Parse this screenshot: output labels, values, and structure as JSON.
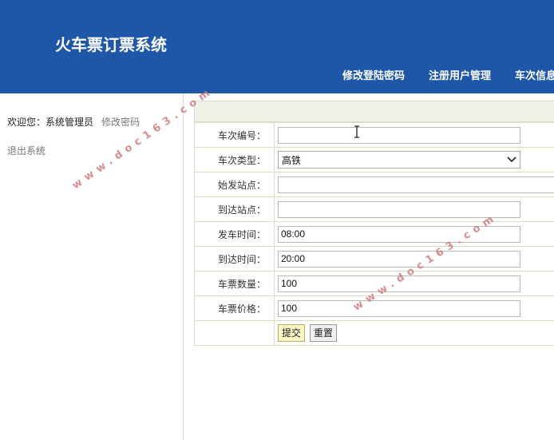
{
  "app": {
    "title": "火车票订票系统"
  },
  "nav": {
    "items": [
      {
        "label": "修改登陆密码"
      },
      {
        "label": "注册用户管理"
      },
      {
        "label": "车次信息"
      }
    ]
  },
  "sidebar": {
    "welcome_prefix": "欢迎您：",
    "user_role": "系统管理员",
    "change_password": "修改密码",
    "logout": "退出系统"
  },
  "form": {
    "fields": [
      {
        "label": "车次编号：",
        "value": ""
      },
      {
        "label": "车次类型：",
        "value": "高铁"
      },
      {
        "label": "始发站点：",
        "value": ""
      },
      {
        "label": "到达站点：",
        "value": ""
      },
      {
        "label": "发车时间：",
        "value": "08:00"
      },
      {
        "label": "到达时间：",
        "value": "20:00"
      },
      {
        "label": "车票数量：",
        "value": "100"
      },
      {
        "label": "车票价格：",
        "value": "100"
      }
    ],
    "submit_label": "提交",
    "reset_label": "重置"
  },
  "watermark": {
    "text": "www.doc163.com"
  }
}
